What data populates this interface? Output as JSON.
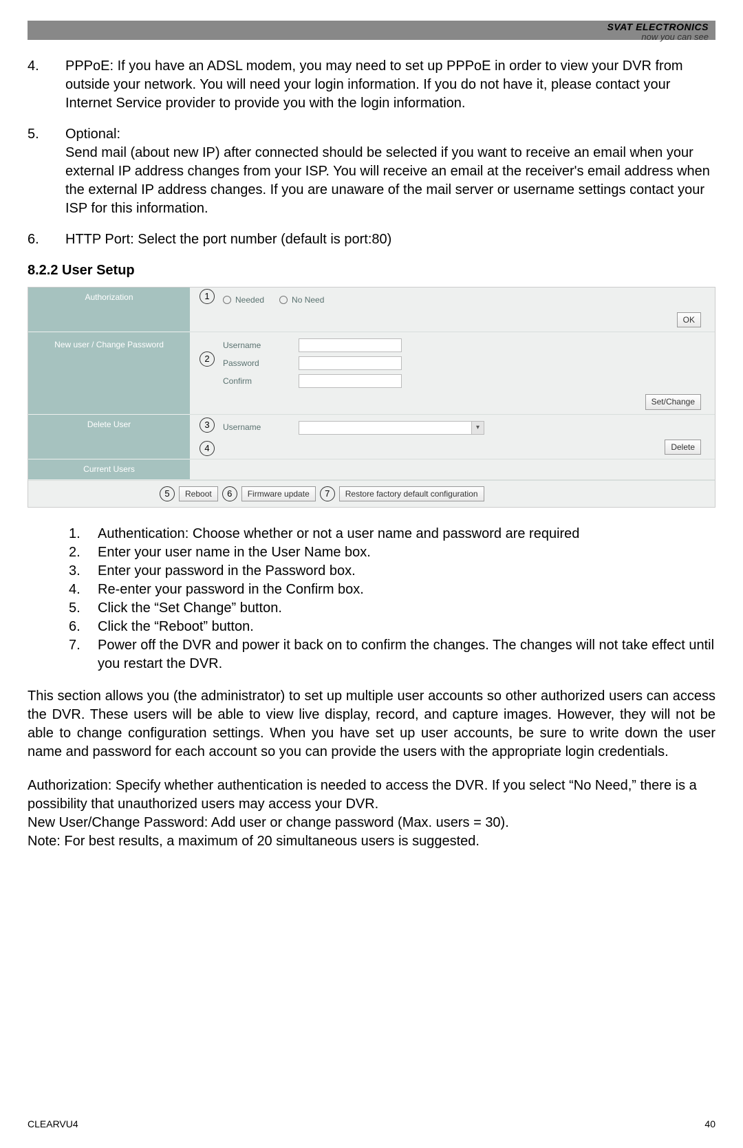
{
  "header": {
    "brand_top": "SVAT ELECTRONICS",
    "brand_sub": "now you can see"
  },
  "list_top": [
    {
      "n": "4.",
      "label": "PPPoE: If you have an ADSL modem, you may need to set up PPPoE in order to view your DVR from outside your network. You will need your login information. If you do not have it, please contact your Internet Service provider to provide you with the login information."
    },
    {
      "n": "5.",
      "label": "Optional:\nSend mail (about new IP) after connected should be selected if you want to receive an email when your external IP address changes from your ISP. You will receive an email at the receiver's email address when the external IP address changes. If you are unaware of the mail server or username settings contact your ISP for this information."
    },
    {
      "n": "6.",
      "label": "HTTP Port: Select the port number (default is port:80)"
    }
  ],
  "section_heading": "8.2.2 User Setup",
  "ui": {
    "rows": {
      "authorization": "Authorization",
      "new_user": "New user / Change Password",
      "delete_user": "Delete User",
      "current_users": "Current Users"
    },
    "radios": {
      "needed": "Needed",
      "no_need": "No Need"
    },
    "fields": {
      "username": "Username",
      "password": "Password",
      "confirm": "Confirm"
    },
    "buttons": {
      "ok": "OK",
      "set_change": "Set/Change",
      "delete": "Delete",
      "reboot": "Reboot",
      "firmware": "Firmware update",
      "restore": "Restore factory default configuration"
    },
    "callouts": {
      "c1": "1",
      "c2": "2",
      "c3": "3",
      "c4": "4",
      "c5": "5",
      "c6": "6",
      "c7": "7"
    }
  },
  "sub_list": [
    {
      "n": "1.",
      "t": "Authentication: Choose whether or not a user name and password are required"
    },
    {
      "n": "2.",
      "t": "Enter your user name in the User Name box."
    },
    {
      "n": "3.",
      "t": "Enter your password in the Password box."
    },
    {
      "n": "4.",
      "t": "Re-enter your password in the Confirm box."
    },
    {
      "n": "5.",
      "t": "Click the “Set Change” button."
    },
    {
      "n": "6.",
      "t": "Click the “Reboot” button."
    },
    {
      "n": "7.",
      "t": "Power off the DVR and power it back on to confirm the changes. The changes will not take effect until you restart the DVR."
    }
  ],
  "para1": "This section allows you (the administrator) to set up multiple user accounts so other authorized users can access the DVR. These users will be able to view live display, record, and capture images. However, they will not be able to change configuration settings. When you have set up user accounts, be sure to write down the user name and password for each account so you can provide the users with the appropriate login credentials.",
  "para2": "Authorization: Specify whether authentication is needed to access the DVR. If you select “No Need,” there is a possibility that unauthorized users may access your DVR.\nNew User/Change Password: Add user or change password (Max. users = 30).\nNote: For best results, a maximum of 20 simultaneous users is suggested.",
  "footer": {
    "left": "CLEARVU4",
    "right": "40"
  }
}
